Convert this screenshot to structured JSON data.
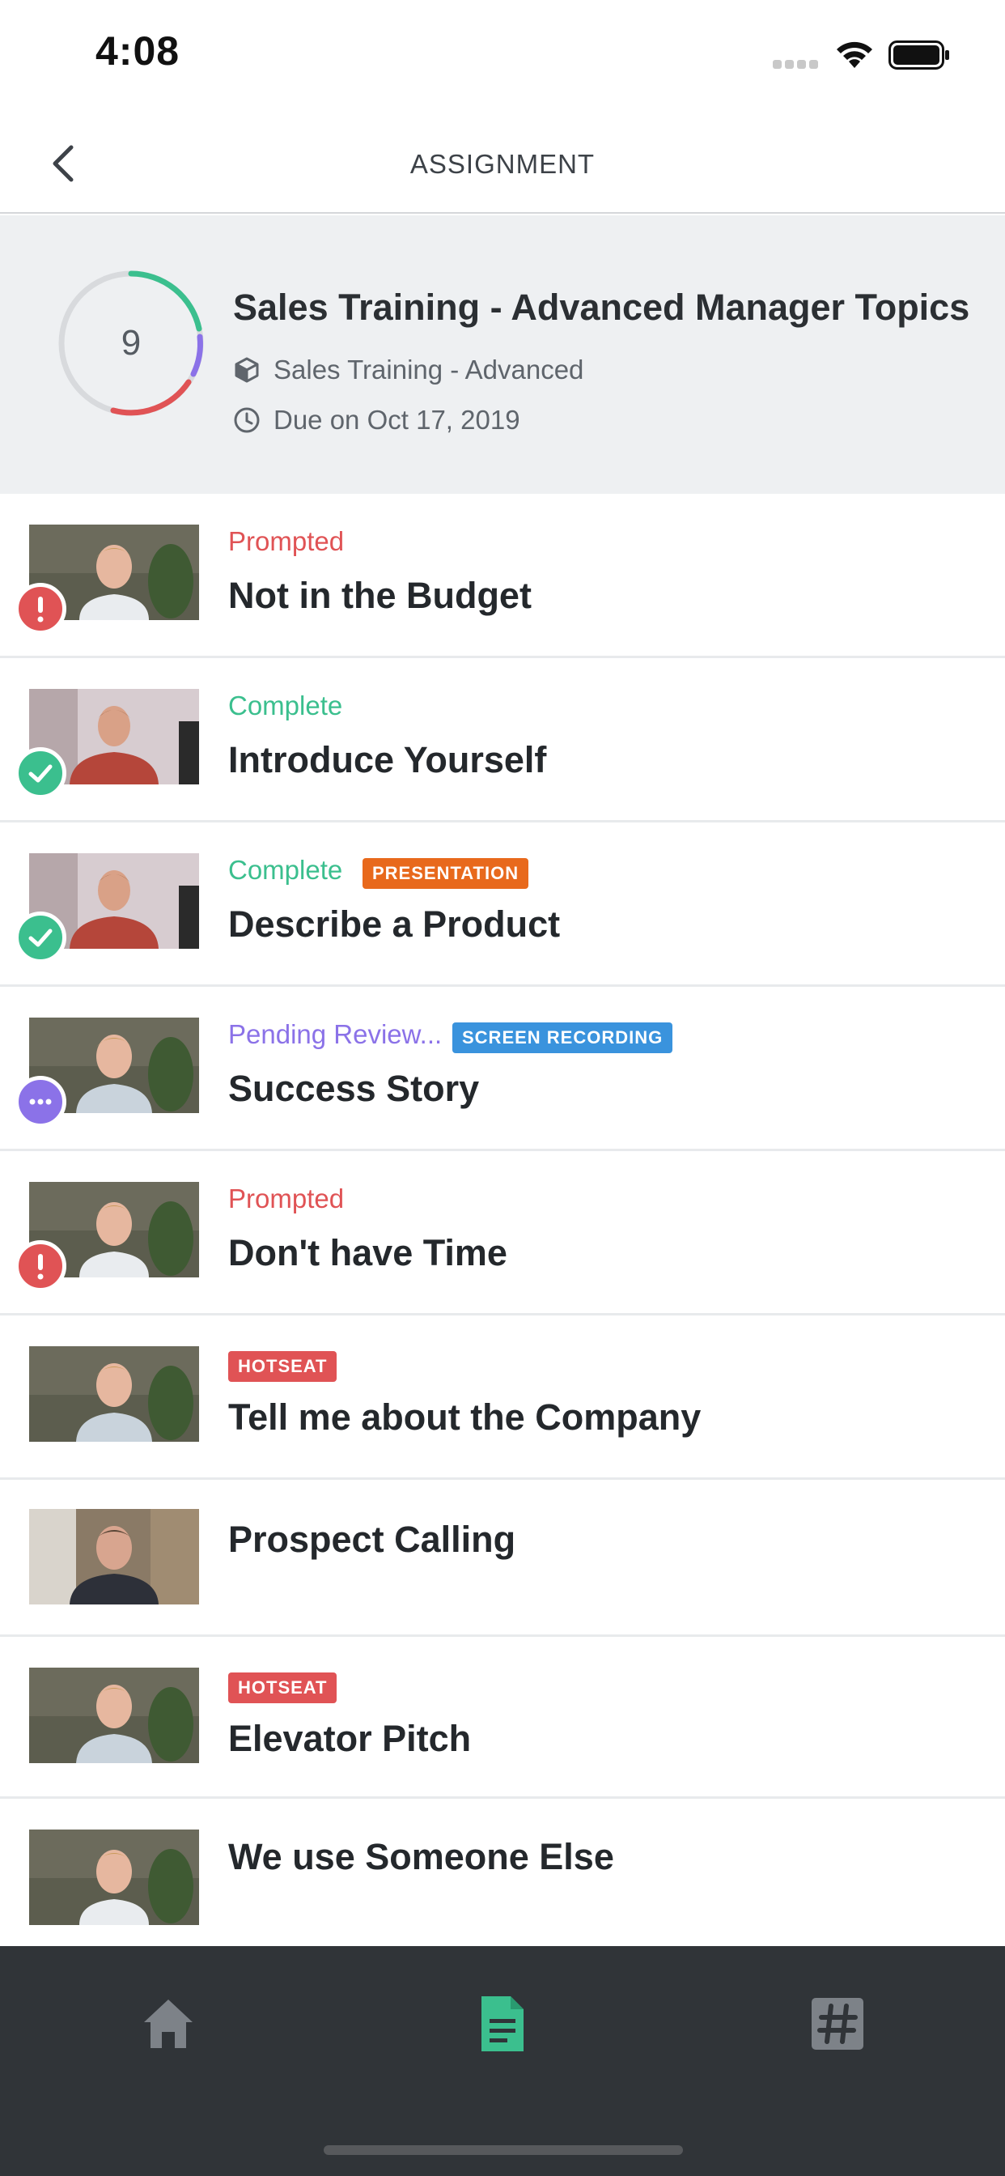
{
  "status_bar": {
    "time": "4:08"
  },
  "nav": {
    "title": "ASSIGNMENT"
  },
  "header": {
    "progress_count": "9",
    "title": "Sales Training - Advanced Manager Topics",
    "course": "Sales Training - Advanced",
    "due": "Due on Oct 17, 2019"
  },
  "colors": {
    "prompted": "#e05355",
    "complete": "#3bbf8e",
    "pending": "#8b72e8",
    "presentation": "#e8691c",
    "screen_recording": "#3a93dd",
    "hotseat": "#e05355",
    "tab_active": "#3bbf8e",
    "tab_inactive": "#7d8288"
  },
  "items": [
    {
      "status": "Prompted",
      "tag": "",
      "title": "Not in the Budget",
      "badge": "alert-icon"
    },
    {
      "status": "Complete",
      "tag": "",
      "title": "Introduce Yourself",
      "badge": "check-icon"
    },
    {
      "status": "Complete",
      "tag": "PRESENTATION",
      "title": "Describe a Product",
      "badge": "check-icon"
    },
    {
      "status": "Pending Review...",
      "tag": "SCREEN RECORDING",
      "title": "Success Story",
      "badge": "more-icon"
    },
    {
      "status": "Prompted",
      "tag": "",
      "title": "Don't have Time",
      "badge": "alert-icon"
    },
    {
      "status": "",
      "tag": "HOTSEAT",
      "title": "Tell me about the Company",
      "badge": ""
    },
    {
      "status": "",
      "tag": "",
      "title": "Prospect Calling",
      "badge": ""
    },
    {
      "status": "",
      "tag": "HOTSEAT",
      "title": "Elevator Pitch",
      "badge": ""
    },
    {
      "status": "",
      "tag": "",
      "title": "We use Someone Else",
      "badge": ""
    }
  ],
  "tabs": [
    {
      "icon": "home-icon"
    },
    {
      "icon": "document-icon"
    },
    {
      "icon": "hashtag-icon"
    }
  ]
}
